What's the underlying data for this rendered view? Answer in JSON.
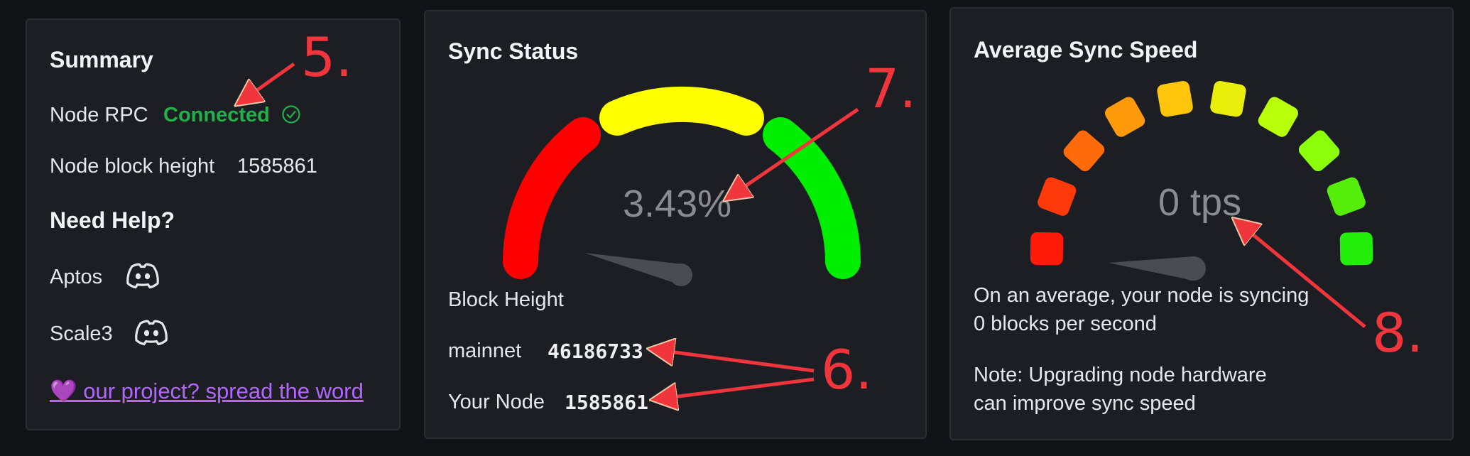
{
  "summary": {
    "title": "Summary",
    "node_rpc_label": "Node RPC",
    "node_rpc_status": "Connected",
    "block_height_label": "Node block height",
    "block_height_value": "1585861",
    "help_title": "Need Help?",
    "help_items": [
      {
        "label": "Aptos",
        "icon": "discord-icon"
      },
      {
        "label": "Scale3",
        "icon": "discord-icon"
      }
    ],
    "share_link": "💜 our project? spread the word",
    "colors": {
      "connected": "#22b04b",
      "link": "#b266ff"
    }
  },
  "sync_status": {
    "title": "Sync Status",
    "gauge_value_text": "3.43%",
    "gauge_value": 3.43,
    "gauge_segments": [
      "#ff0000",
      "#ffff00",
      "#00ee00"
    ],
    "block_height_label": "Block Height",
    "rows": [
      {
        "label": "mainnet",
        "value": "46186733"
      },
      {
        "label": "Your Node",
        "value": "1585861"
      }
    ]
  },
  "avg_speed": {
    "title": "Average Sync Speed",
    "gauge_value_text": "0 tps",
    "gauge_value": 0,
    "segment_colors": [
      "#ff1a0a",
      "#ff3a0a",
      "#ff6a0a",
      "#ff9a0a",
      "#ffc50a",
      "#e8ee0a",
      "#b8ff0a",
      "#8cff0a",
      "#55ee0a",
      "#22ee0a"
    ],
    "description_line1": "On an average, your node is syncing",
    "description_line2": "0 blocks per second",
    "note_line1": "Note: Upgrading node hardware",
    "note_line2": "can improve sync speed"
  },
  "annotations": {
    "n5": "5.",
    "n6": "6.",
    "n7": "7.",
    "n8": "8.",
    "color": "#f0353c"
  }
}
